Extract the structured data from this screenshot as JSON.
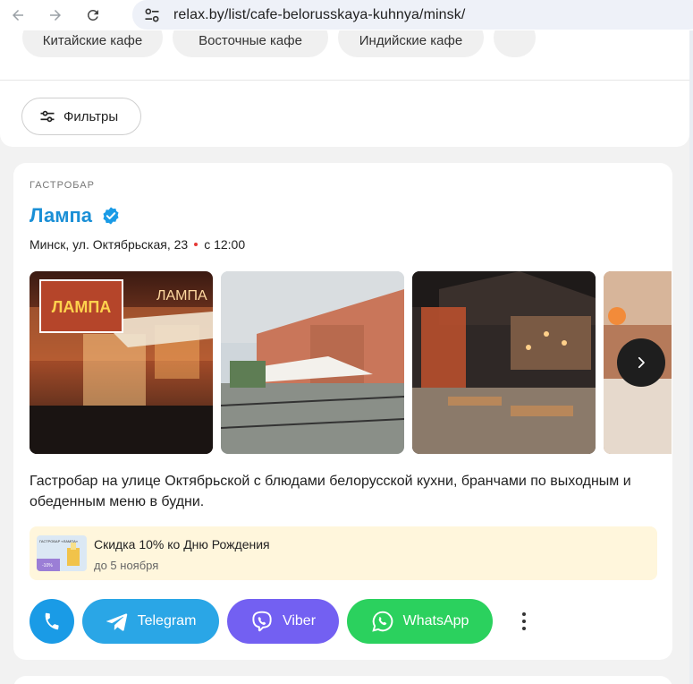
{
  "browser": {
    "url": "relax.by/list/cafe-belorusskaya-kuhnya/minsk/"
  },
  "filters": {
    "chips": [
      "Китайские кафе",
      "Восточные кафе",
      "Индийские кафе",
      ""
    ],
    "filter_button_label": "Фильтры"
  },
  "listing": {
    "category": "ГАСТРОБАР",
    "name": "Лампа",
    "verified": true,
    "address": "Минск, ул. Октябрьская, 23",
    "hours": "с 12:00",
    "photo_sign": "ЛАМПА",
    "description": "Гастробар на улице Октябрьской с блюдами белорусской кухни, бранчами по выходным и обеденным меню в будни.",
    "promo": {
      "title": "Скидка 10% ко Дню Рождения",
      "date": "до 5 ноября",
      "thumb_text": "ГАСТРОБАР «ЛАМПА»",
      "thumb_badge": "-10%"
    },
    "actions": {
      "telegram": "Telegram",
      "viber": "Viber",
      "whatsapp": "WhatsApp"
    }
  },
  "colors": {
    "brand_blue": "#1a8fd6",
    "telegram": "#2aa6e6",
    "viber": "#7360f2",
    "whatsapp": "#2bd15e",
    "promo_bg": "#fff6dc"
  }
}
